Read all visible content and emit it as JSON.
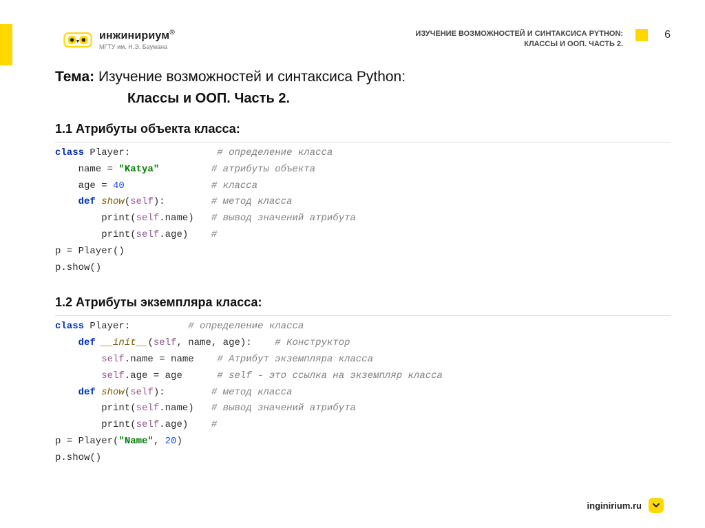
{
  "brand": {
    "name": "инжинириум",
    "reg": "®",
    "sub": "МГТУ им. Н.Э. Баумана"
  },
  "header": {
    "subtitle_line1": "ИЗУЧЕНИЕ ВОЗМОЖНОСТЕЙ И СИНТАКСИСА PYTHON:",
    "subtitle_line2": "КЛАССЫ И ООП. ЧАСТЬ 2.",
    "page_number": "6"
  },
  "topic": {
    "label": "Тема:",
    "line1": " Изучение возможностей и синтаксиса Python:",
    "line2": "Классы и ООП. Часть 2."
  },
  "section1": {
    "title": "1.1 Атрибуты объекта класса:",
    "code": {
      "l1": {
        "kw": "class",
        "name": " Player:",
        "cmt": "# определение класса"
      },
      "l2": {
        "pre": "    name = ",
        "str": "\"Katya\"",
        "cmt": "# атрибуты объекта"
      },
      "l3": {
        "pre": "    age = ",
        "num": "40",
        "cmt": "# класса"
      },
      "l4": {
        "kw": "    def",
        "fn": " show",
        "args_open": "(",
        "self": "self",
        "args_close": "):",
        "cmt": "# метод класса"
      },
      "l5": {
        "pre": "        print(",
        "self": "self",
        "rest": ".name)",
        "cmt": "# вывод значений атрибута"
      },
      "l6": {
        "pre": "        print(",
        "self": "self",
        "rest": ".age)",
        "cmt": "#"
      },
      "l7": {
        "text": "p = Player()"
      },
      "l8": {
        "text": "p.show()"
      }
    }
  },
  "section2": {
    "title": "1.2 Атрибуты экземпляра класса:",
    "code": {
      "l1": {
        "kw": "class",
        "name": " Player:",
        "cmt": "# определение класса"
      },
      "l2": {
        "kw": "    def",
        "fn": " __init__",
        "args_open": "(",
        "self": "self",
        "args_rest": ", name, age):",
        "cmt": "# Конструктор"
      },
      "l3": {
        "pre": "        ",
        "self": "self",
        "rest": ".name = name",
        "cmt": "# Атрибут экземпляра класса"
      },
      "l4": {
        "pre": "        ",
        "self": "self",
        "rest": ".age = age",
        "cmt": "# self - это ссылка на экземпляр класса"
      },
      "l5": {
        "kw": "    def",
        "fn": " show",
        "args_open": "(",
        "self": "self",
        "args_close": "):",
        "cmt": "# метод класса"
      },
      "l6": {
        "pre": "        print(",
        "self": "self",
        "rest": ".name)",
        "cmt": "# вывод значений атрибута"
      },
      "l7": {
        "pre": "        print(",
        "self": "self",
        "rest": ".age)",
        "cmt": "#"
      },
      "l8": {
        "text_a": "p = Player(",
        "str": "\"Name\"",
        "text_b": ", ",
        "num": "20",
        "text_c": ")"
      },
      "l9": {
        "text": "p.show()"
      }
    }
  },
  "footer": {
    "url": "inginirium.ru"
  }
}
